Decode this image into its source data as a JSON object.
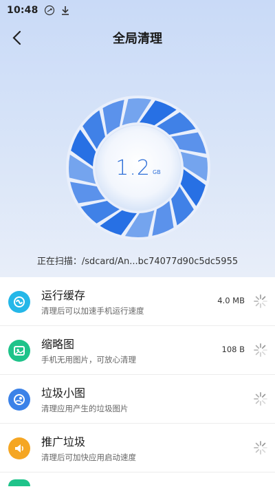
{
  "status_bar": {
    "time": "10:48"
  },
  "header": {
    "title": "全局清理"
  },
  "dial": {
    "value": "1.2",
    "unit": "GB"
  },
  "scan": {
    "text": "正在扫描：/sdcard/An...bc74077d90c5dc5955"
  },
  "items": [
    {
      "title": "运行缓存",
      "subtitle": "清理后可以加速手机运行速度",
      "size": "4.0 MB",
      "icon": "cache-icon",
      "color": "#25b7e8"
    },
    {
      "title": "缩略图",
      "subtitle": "手机无用图片，可放心清理",
      "size": "108 B",
      "icon": "thumbnail-icon",
      "color": "#1fc38a"
    },
    {
      "title": "垃圾小图",
      "subtitle": "清理应用产生的垃圾图片",
      "size": "",
      "icon": "junk-image-icon",
      "color": "#3b82e8"
    },
    {
      "title": "推广垃圾",
      "subtitle": "清理后可加快应用启动速度",
      "size": "",
      "icon": "promo-junk-icon",
      "color": "#f5a623"
    }
  ]
}
